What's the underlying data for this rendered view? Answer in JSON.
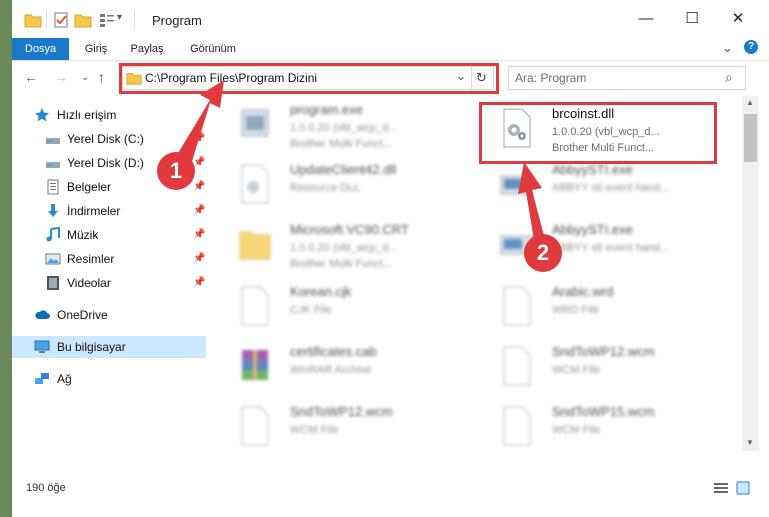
{
  "window": {
    "title": "Program",
    "controls": {
      "minimize": "—",
      "maximize": "☐",
      "close": "✕"
    }
  },
  "ribbon": {
    "tabs": [
      "Dosya",
      "Giriş",
      "Paylaş",
      "Görünüm"
    ],
    "expand": "⌄",
    "help": "?"
  },
  "nav": {
    "back": "←",
    "forward": "→",
    "recent": "⌄",
    "up": "↑",
    "address": "C:\\Program Files\\Program Dizini",
    "address_dropdown": "⌄",
    "refresh": "↻",
    "search_placeholder": "Ara: Program",
    "search_icon": "⌕"
  },
  "sidebar": {
    "items": [
      {
        "label": "Hızlı erişim",
        "icon": "star-icon",
        "pinned": false
      },
      {
        "label": "Yerel Disk (C:)",
        "icon": "drive-icon",
        "pinned": true
      },
      {
        "label": "Yerel Disk (D:)",
        "icon": "drive-icon",
        "pinned": true
      },
      {
        "label": "Belgeler",
        "icon": "documents-icon",
        "pinned": true
      },
      {
        "label": "İndirmeler",
        "icon": "download-icon",
        "pinned": true
      },
      {
        "label": "Müzik",
        "icon": "music-icon",
        "pinned": true
      },
      {
        "label": "Resimler",
        "icon": "pictures-icon",
        "pinned": true
      },
      {
        "label": "Videolar",
        "icon": "video-icon",
        "pinned": true
      },
      {
        "label": "OneDrive",
        "icon": "cloud-icon",
        "pinned": false
      },
      {
        "label": "Bu bilgisayar",
        "icon": "computer-icon",
        "pinned": false
      },
      {
        "label": "Ağ",
        "icon": "network-icon",
        "pinned": false
      }
    ],
    "pin_glyph": "📌"
  },
  "files": [
    {
      "name": "program.exe",
      "line2": "1.0.0.20 (vbl_wcp_d...",
      "line3": "Brother Multi Funct...",
      "icon": "exe-icon"
    },
    {
      "name": "brcoinst.dll",
      "line2": "1.0.0.20 (vbl_wcp_d...",
      "line3": "Brother Multi Funct...",
      "icon": "dll-gear-icon"
    },
    {
      "name": "UpdateClient42.dll",
      "line2": "Resource DLL",
      "line3": "",
      "icon": "dll-icon"
    },
    {
      "name": "AbbyySTI.exe",
      "line2": "ABBYY sti event hand...",
      "line3": "",
      "icon": "scanner-icon"
    },
    {
      "name": "Microsoft.VC90.CRT",
      "line2": "1.0.0.20 (vbl_wcp_d...",
      "line3": "Brother Multi Funct...",
      "icon": "folder-icon"
    },
    {
      "name": "AbbyySTI.exe",
      "line2": "ABBYY sti event hand...",
      "line3": "",
      "icon": "scanner-icon"
    },
    {
      "name": "Korean.cjk",
      "line2": "CJK File",
      "line3": "",
      "icon": "file-icon"
    },
    {
      "name": "Arabic.wrd",
      "line2": "WRD File",
      "line3": "",
      "icon": "file-icon"
    },
    {
      "name": "certificates.cab",
      "line2": "WinRAR Archive",
      "line3": "",
      "icon": "archive-icon"
    },
    {
      "name": "SndToWP12.wcm",
      "line2": "WCM File",
      "line3": "",
      "icon": "file-icon"
    },
    {
      "name": "SndToWP12.wcm",
      "line2": "WCM File",
      "line3": "",
      "icon": "file-icon"
    },
    {
      "name": "SndToWP15.wcm",
      "line2": "WCM File",
      "line3": "",
      "icon": "file-icon"
    }
  ],
  "status": {
    "count": "190 öğe"
  },
  "annotations": {
    "step1": "1",
    "step2": "2",
    "color": "#e03a3e"
  },
  "colors": {
    "accent": "#1979ca",
    "selected": "#cce8ff"
  }
}
